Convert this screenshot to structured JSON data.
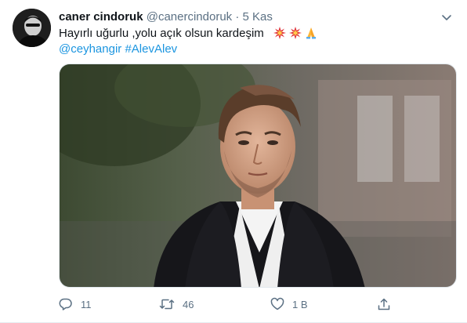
{
  "tweet": {
    "author_name": "caner cindoruk",
    "handle": "@canercindoruk",
    "separator": "·",
    "date": "5 Kas",
    "text": "Hayırlı uğurlu ,yolu açık olsun kardeşim",
    "emojis": [
      "collision-icon",
      "collision-icon",
      "folded-hands-icon"
    ],
    "mention": "@ceyhangir",
    "hashtag": "#AlevAlev",
    "actions": {
      "reply_count": "11",
      "retweet_count": "46",
      "like_count": "1 B"
    }
  },
  "colors": {
    "link": "#1b95e0",
    "secondary_text": "#5b7083",
    "primary_text": "#0f1419"
  }
}
